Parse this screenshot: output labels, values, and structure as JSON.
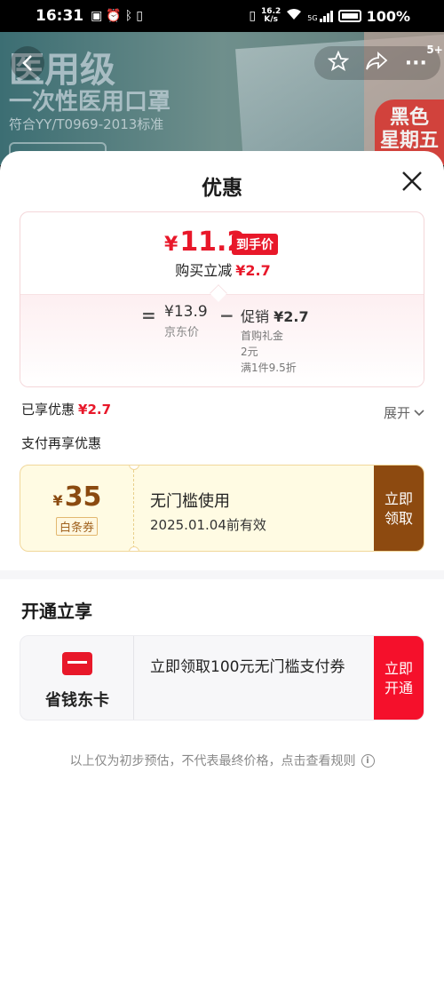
{
  "status_bar": {
    "time": "16:31",
    "net_speed_value": "16.2",
    "net_speed_unit": "K/s",
    "signal_label": "5G",
    "battery": "100%"
  },
  "banner": {
    "title": "医用级",
    "subtitle": "一次性医用口罩",
    "standard": "符合YY/T0969-2013标准",
    "badge_line1": "黑色",
    "badge_line2": "星期五",
    "cart_count": "5+"
  },
  "sheet": {
    "title": "优惠",
    "final_price_symbol": "¥",
    "final_price": "11.2",
    "final_price_tag": "到手价",
    "instant_reduce_label": "购买立减",
    "instant_reduce_amount": "¥2.7",
    "eq_sign": "=",
    "jd_price_value": "¥13.9",
    "jd_price_label": "京东价",
    "minus_sign": "−",
    "promo_label": "促销",
    "promo_amount": "¥2.7",
    "promo_detail_1": "首购礼金",
    "promo_detail_2": "2元",
    "promo_detail_3": "满1件9.5折",
    "enjoyed_label": "已享优惠",
    "enjoyed_amount": "¥2.7",
    "expand_label": "展开",
    "pay_again_label": "支付再享优惠"
  },
  "coupon": {
    "symbol": "¥",
    "amount": "35",
    "type": "白条券",
    "line1": "无门槛使用",
    "line2": "2025.01.04前有效",
    "button_line1": "立即",
    "button_line2": "领取"
  },
  "open_section": {
    "title": "开通立享",
    "card_name": "省钱东卡",
    "card_text": "立即领取100元无门槛支付券",
    "button_line1": "立即",
    "button_line2": "开通"
  },
  "footnote": "以上仅为初步预估，不代表最终价格，点击查看规则",
  "colors": {
    "accent_red": "#e8182a",
    "coupon_brown": "#8d4a10",
    "open_red": "#f5102b"
  }
}
